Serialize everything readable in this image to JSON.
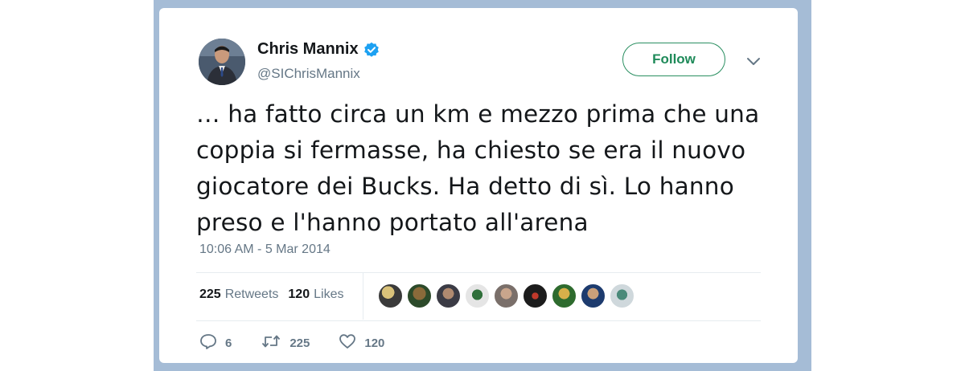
{
  "author": {
    "display_name": "Chris Mannix",
    "handle": "@SIChrisMannix",
    "verified": true
  },
  "follow_button": {
    "label": "Follow"
  },
  "tweet": {
    "text": "… ha fatto circa un km e mezzo prima che una coppia si fermasse, ha chiesto se era il nuovo giocatore dei Bucks. Ha detto di sì. Lo hanno preso e l'hanno portato all'arena",
    "timestamp": "10:06 AM - 5 Mar 2014"
  },
  "stats": {
    "retweets_count": "225",
    "retweets_label": "Retweets",
    "likes_count": "120",
    "likes_label": "Likes"
  },
  "actions": {
    "reply_count": "6",
    "retweet_count": "225",
    "like_count": "120"
  },
  "colors": {
    "frame": "#a5bcd6",
    "follow_green": "#1e8a59",
    "verified_blue": "#1da1f2",
    "muted_gray": "#657786"
  }
}
